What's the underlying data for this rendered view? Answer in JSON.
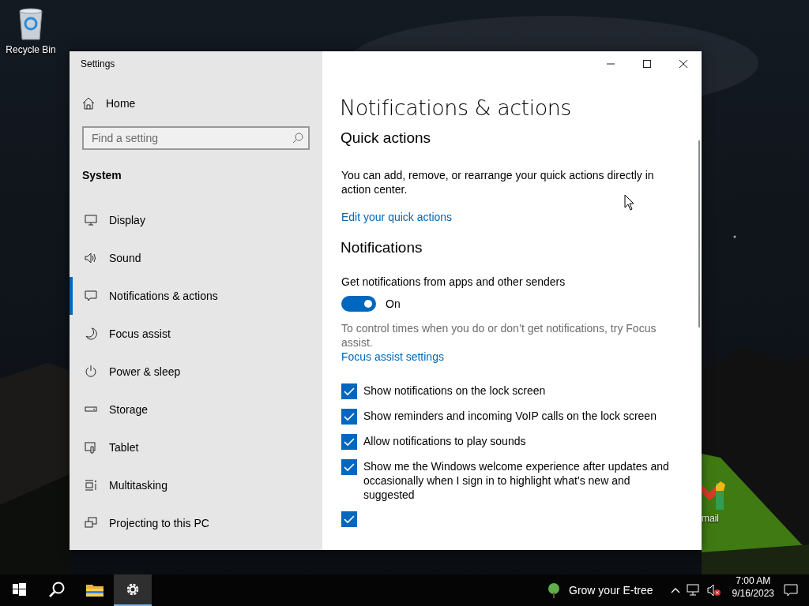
{
  "desktop": {
    "icons": [
      {
        "label": "Recycle Bin"
      },
      {
        "label": "mail"
      }
    ]
  },
  "window": {
    "title": "Settings",
    "sidebar": {
      "home": "Home",
      "search": {
        "placeholder": "Find a setting"
      },
      "section": "System",
      "items": [
        {
          "label": "Display",
          "selected": false
        },
        {
          "label": "Sound",
          "selected": false
        },
        {
          "label": "Notifications & actions",
          "selected": true
        },
        {
          "label": "Focus assist",
          "selected": false
        },
        {
          "label": "Power & sleep",
          "selected": false
        },
        {
          "label": "Storage",
          "selected": false
        },
        {
          "label": "Tablet",
          "selected": false
        },
        {
          "label": "Multitasking",
          "selected": false
        },
        {
          "label": "Projecting to this PC",
          "selected": false
        }
      ]
    },
    "content": {
      "title": "Notifications & actions",
      "blocks": [
        {
          "kind": "heading",
          "text": "Quick actions"
        },
        {
          "kind": "paragraph",
          "text": "You can add, remove, or rearrange your quick actions directly in action center."
        },
        {
          "kind": "link",
          "text": "Edit your quick actions"
        },
        {
          "kind": "heading",
          "text": "Notifications"
        },
        {
          "kind": "toggle",
          "label": "Get notifications from apps and other senders",
          "on": true,
          "state_text": "On"
        },
        {
          "kind": "note",
          "text": "To control times when you do or don’t get notifications, try Focus assist."
        },
        {
          "kind": "link",
          "text": "Focus assist settings"
        },
        {
          "kind": "checkbox",
          "label": "Show notifications on the lock screen",
          "checked": true
        },
        {
          "kind": "checkbox",
          "label": "Show reminders and incoming VoIP calls on the lock screen",
          "checked": true
        },
        {
          "kind": "checkbox",
          "label": "Allow notifications to play sounds",
          "checked": true
        },
        {
          "kind": "checkbox",
          "label": "Show me the Windows welcome experience after updates and occasionally when I sign in to highlight what’s new and suggested",
          "checked": true
        },
        {
          "kind": "checkbox",
          "checked": true
        }
      ]
    }
  },
  "taskbar": {
    "buttons": [
      {
        "selected": false
      },
      {
        "selected": false
      },
      {
        "selected": false
      },
      {
        "selected": true
      }
    ],
    "news": "Grow your E-tree",
    "time": "7:00 AM",
    "date": "9/16/2023"
  }
}
